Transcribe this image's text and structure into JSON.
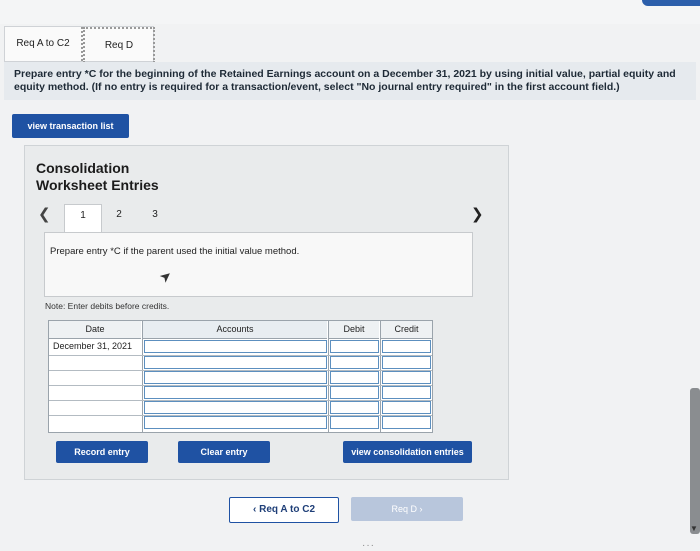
{
  "tabs": [
    {
      "label": "Req A to C2"
    },
    {
      "label": "Req D"
    }
  ],
  "instruction": {
    "main": "Prepare entry *C for the beginning of the Retained Earnings account on a December 31, 2021 by using initial value, partial equity and equity method.",
    "note": "(If no entry is required for a transaction/event, select \"No journal entry required\" in the first account field.)"
  },
  "buttons": {
    "view_transaction_list": "view transaction list",
    "record_entry": "Record entry",
    "clear_entry": "Clear entry",
    "view_consolidation_entries": "view consolidation entries"
  },
  "worksheet": {
    "title_line1": "Consolidation",
    "title_line2": "Worksheet Entries",
    "pages": [
      "1",
      "2",
      "3"
    ],
    "prev_icon": "chevron-left-icon",
    "next_icon": "chevron-right-icon",
    "prompt": "Prepare entry *C if the parent used the initial value method.",
    "note": "Note: Enter debits before credits."
  },
  "table": {
    "headers": {
      "date": "Date",
      "accounts": "Accounts",
      "debit": "Debit",
      "credit": "Credit"
    },
    "rows": [
      {
        "date": "December 31, 2021"
      },
      {
        "date": ""
      },
      {
        "date": ""
      },
      {
        "date": ""
      },
      {
        "date": ""
      },
      {
        "date": ""
      }
    ]
  },
  "nav": {
    "prev_label": "Req A to C2",
    "next_label": "Req D",
    "prev_arrow": "‹",
    "next_arrow": "›"
  },
  "colors": {
    "primary_button": "#1f52a3",
    "disabled_button": "#b8c6dc",
    "instruction_band": "#e6eaee",
    "input_border": "#5c8fbf"
  }
}
